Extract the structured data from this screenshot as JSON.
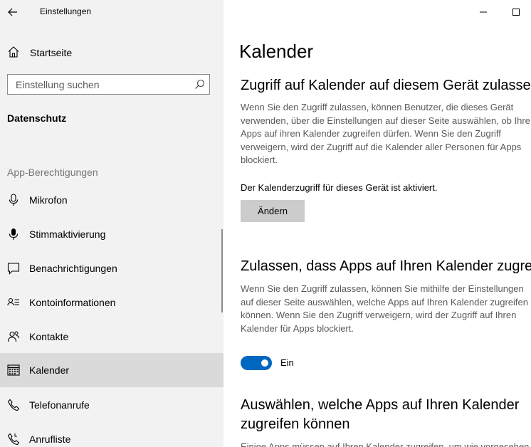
{
  "window": {
    "app_title": "Einstellungen",
    "back_icon": "back-arrow-icon",
    "minimize_icon": "minimize-icon",
    "maximize_icon": "maximize-icon"
  },
  "sidebar": {
    "home_label": "Startseite",
    "home_icon": "home-icon",
    "search_placeholder": "Einstellung suchen",
    "search_icon": "search-icon",
    "section_title": "Datenschutz",
    "group_label": "App-Berechtigungen",
    "items": [
      {
        "label": "Mikrofon",
        "icon": "microphone-icon",
        "selected": false
      },
      {
        "label": "Stimmaktivierung",
        "icon": "voice-activation-icon",
        "selected": false
      },
      {
        "label": "Benachrichtigungen",
        "icon": "notifications-icon",
        "selected": false
      },
      {
        "label": "Kontoinformationen",
        "icon": "account-info-icon",
        "selected": false
      },
      {
        "label": "Kontakte",
        "icon": "contacts-icon",
        "selected": false
      },
      {
        "label": "Kalender",
        "icon": "calendar-icon",
        "selected": true
      },
      {
        "label": "Telefonanrufe",
        "icon": "phone-icon",
        "selected": false
      },
      {
        "label": "Anrufliste",
        "icon": "call-history-icon",
        "selected": false
      }
    ]
  },
  "main": {
    "page_title": "Kalender",
    "device_access": {
      "heading": "Zugriff auf Kalender auf diesem Gerät zulassen",
      "description": "Wenn Sie den Zugriff zulassen, können Benutzer, die dieses Gerät\nverwenden, über die Einstellungen auf dieser Seite auswählen, ob Ihre\nApps auf ihren Kalender zugreifen dürfen. Wenn Sie den Zugriff\nverweigern, wird der Zugriff auf die Kalender aller Personen für Apps\nblockiert.",
      "status": "Der Kalenderzugriff für dieses Gerät ist aktiviert.",
      "change_button": "Ändern"
    },
    "app_access": {
      "heading": "Zulassen, dass Apps auf Ihren Kalender zugreifen",
      "description": "Wenn Sie den Zugriff zulassen, können Sie mithilfe der Einstellungen\nauf dieser Seite auswählen, welche Apps auf Ihren Kalender zugreifen\nkönnen. Wenn Sie den Zugriff verweigern, wird der Zugriff auf Ihren\nKalender für Apps blockiert.",
      "toggle_on": true,
      "toggle_label": "Ein"
    },
    "choose_apps": {
      "heading_line1": "Auswählen, welche Apps auf Ihren Kalender",
      "heading_line2": "zugreifen können",
      "description": "Einige Apps müssen auf Ihren Kalender zugreifen, um wie vorgesehen"
    }
  },
  "colors": {
    "sidebar_bg": "#f2f2f2",
    "selected_bg": "#dadada",
    "accent": "#0067c0",
    "button_bg": "#cccccc"
  }
}
